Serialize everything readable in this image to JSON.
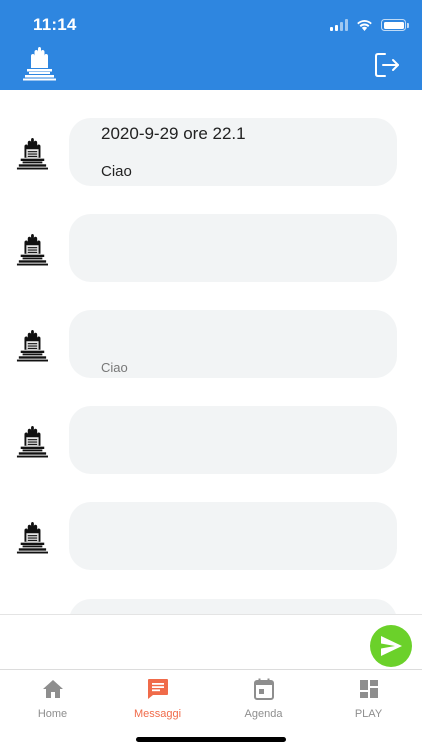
{
  "status_bar": {
    "time": "11:14"
  },
  "colors": {
    "header": "#2e86e0",
    "bubble": "#f2f4f5",
    "send": "#6bd12a",
    "active_tab": "#f06b4a",
    "inactive_tab": "#8e8e8e"
  },
  "header": {
    "logo_icon": "praying-hands-logo-icon",
    "logout_icon": "logout-icon"
  },
  "messages": [
    {
      "date": "2020-9-29 ore 22.1",
      "text": "Ciao",
      "partial": ""
    },
    {
      "date": "",
      "text": "",
      "partial": ""
    },
    {
      "date": "",
      "text": "",
      "partial": "Ciao"
    },
    {
      "date": "",
      "text": "",
      "partial": ""
    },
    {
      "date": "",
      "text": "",
      "partial": ""
    },
    {
      "date": "",
      "text": "",
      "partial": ""
    }
  ],
  "compose": {
    "placeholder": "",
    "value": ""
  },
  "tabs": [
    {
      "label": "Home",
      "icon": "home-icon",
      "active": false
    },
    {
      "label": "Messaggi",
      "icon": "chat-icon",
      "active": true
    },
    {
      "label": "Agenda",
      "icon": "calendar-icon",
      "active": false
    },
    {
      "label": "PLAY",
      "icon": "dashboard-icon",
      "active": false
    }
  ]
}
